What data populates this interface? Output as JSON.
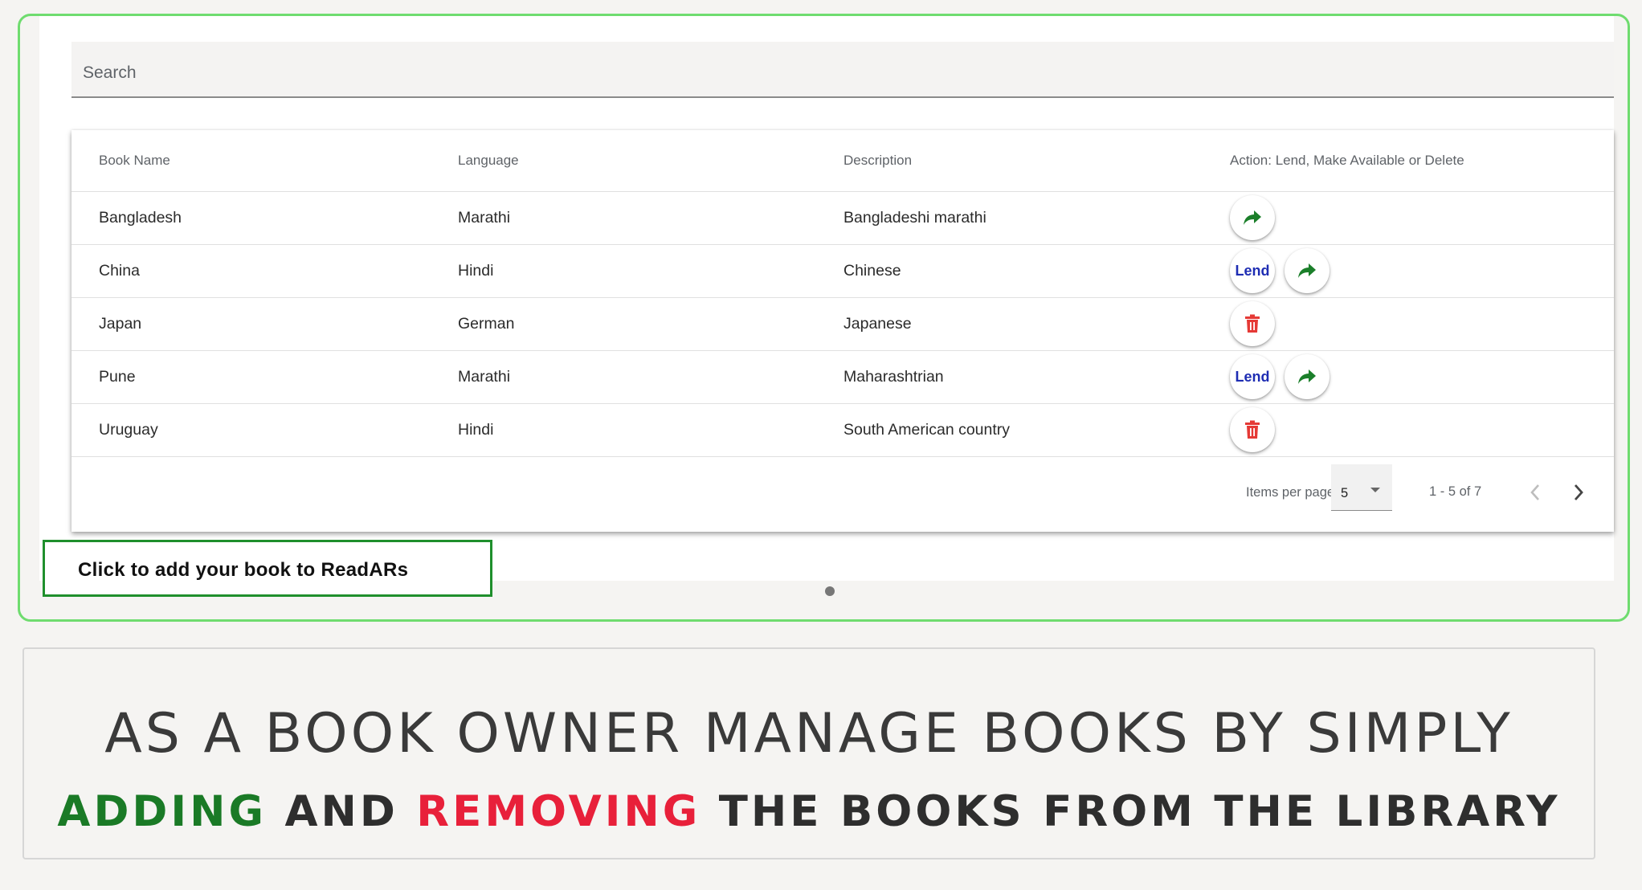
{
  "search": {
    "placeholder": "Search"
  },
  "table": {
    "headers": [
      "Book Name",
      "Language",
      "Description",
      "Action: Lend, Make Available or Delete"
    ],
    "rows": [
      {
        "book": "Bangladesh",
        "language": "Marathi",
        "description": "Bangladeshi marathi",
        "actions": [
          "share"
        ]
      },
      {
        "book": "China",
        "language": "Hindi",
        "description": "Chinese",
        "actions": [
          "lend",
          "share"
        ]
      },
      {
        "book": "Japan",
        "language": "German",
        "description": "Japanese",
        "actions": [
          "delete"
        ]
      },
      {
        "book": "Pune",
        "language": "Marathi",
        "description": "Maharashtrian",
        "actions": [
          "lend",
          "share"
        ]
      },
      {
        "book": "Uruguay",
        "language": "Hindi",
        "description": "South American country",
        "actions": [
          "delete"
        ]
      }
    ],
    "lend_label": "Lend"
  },
  "paginator": {
    "items_per_page_label": "Items per page:",
    "items_per_page_value": "5",
    "range_label": "1 - 5 of 7"
  },
  "add_book_label": "Click to add your book to ReadARs",
  "caption": {
    "line1": "AS A BOOK OWNER MANAGE BOOKS BY SIMPLY",
    "line2_word1": "ADDING",
    "line2_word2": " AND ",
    "line2_word3": "REMOVING",
    "line2_rest": " THE BOOKS FROM THE LIBRARY"
  },
  "colors": {
    "share_icon": "#1b7f2a",
    "delete_icon": "#e53935",
    "lend_text": "#1e2db3",
    "frame_border": "#6fdc6f",
    "add_button_border": "#1f8f2c",
    "caption_green": "#1a7a26",
    "caption_red": "#e8203a"
  },
  "icons": {
    "share": "share-forward-icon",
    "delete": "trash-icon",
    "prev": "chevron-left-icon",
    "next": "chevron-right-icon",
    "dropdown": "caret-down-icon"
  }
}
